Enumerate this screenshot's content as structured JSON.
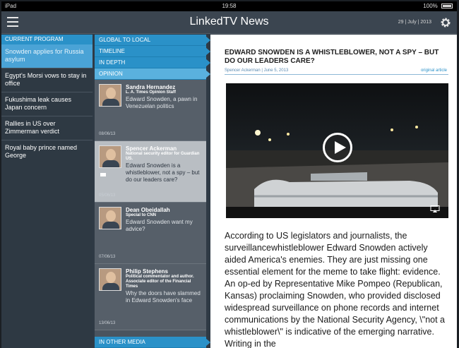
{
  "status_bar": {
    "device": "iPad",
    "time": "19:58",
    "battery": "100%"
  },
  "header": {
    "title": "LinkedTV News",
    "date": "29 | July | 2013"
  },
  "program": {
    "heading": "CURRENT PROGRAM",
    "items": [
      {
        "label": "Snowden applies for Russia asylum"
      },
      {
        "label": "Egypt's Morsi vows to stay in office"
      },
      {
        "label": "Fukushima leak causes Japan concern"
      },
      {
        "label": "Rallies in US over Zimmerman verdict"
      },
      {
        "label": "Royal baby prince named George"
      }
    ]
  },
  "categories": {
    "tabs": [
      {
        "label": "GLOBAL TO LOCAL"
      },
      {
        "label": "TIMELINE"
      },
      {
        "label": "IN DEPTH"
      },
      {
        "label": "OPINION"
      }
    ],
    "bottom_tab": "IN OTHER MEDIA"
  },
  "opinions": [
    {
      "name": "Sandra Hernandez",
      "role": "L. A. Times Opinion Staff",
      "headline": "Edward Snowden, a pawn in Venezuelan politics",
      "date": "08/06/13"
    },
    {
      "name": "Spencer Ackerman",
      "role": "National security editor for Guardian US.",
      "headline": "Edward Snowden is a whistleblower, not a spy – but do our leaders care?",
      "date": "05/06/13"
    },
    {
      "name": "Dean Obeidallah",
      "role": "Special to CNN",
      "headline": "Edward Snowden want my advice?",
      "date": "07/06/13"
    },
    {
      "name": "Philip Stephens",
      "role": "Political commentator and author. Associate editor of the Financial Times",
      "headline": "Why the doors have slammed in Edward Snowden's face",
      "date": "13/06/13"
    }
  ],
  "article": {
    "title": "EDWARD SNOWDEN IS A WHISTLEBLOWER, NOT A SPY – BUT DO OUR LEADERS CARE?",
    "meta": "Spencer Ackerman  |  June 5, 2013",
    "original_link": "original article",
    "body": "According to US legislators and journalists, the surveillancewhistleblower Edward Snowden actively aided America's enemies. They are just missing one essential element for the meme to take flight: evidence. An op-ed by Representative Mike Pompeo (Republican, Kansas) proclaiming Snowden, who provided disclosed widespread surveillance on phone records and internet communications by the National Security Agency, \\\"not a whistleblower\\\" is indicative of the emerging narrative. Writing in the"
  },
  "colors": {
    "accent": "#2a91c8",
    "panel": "#2e3943",
    "header": "#3b4550"
  }
}
